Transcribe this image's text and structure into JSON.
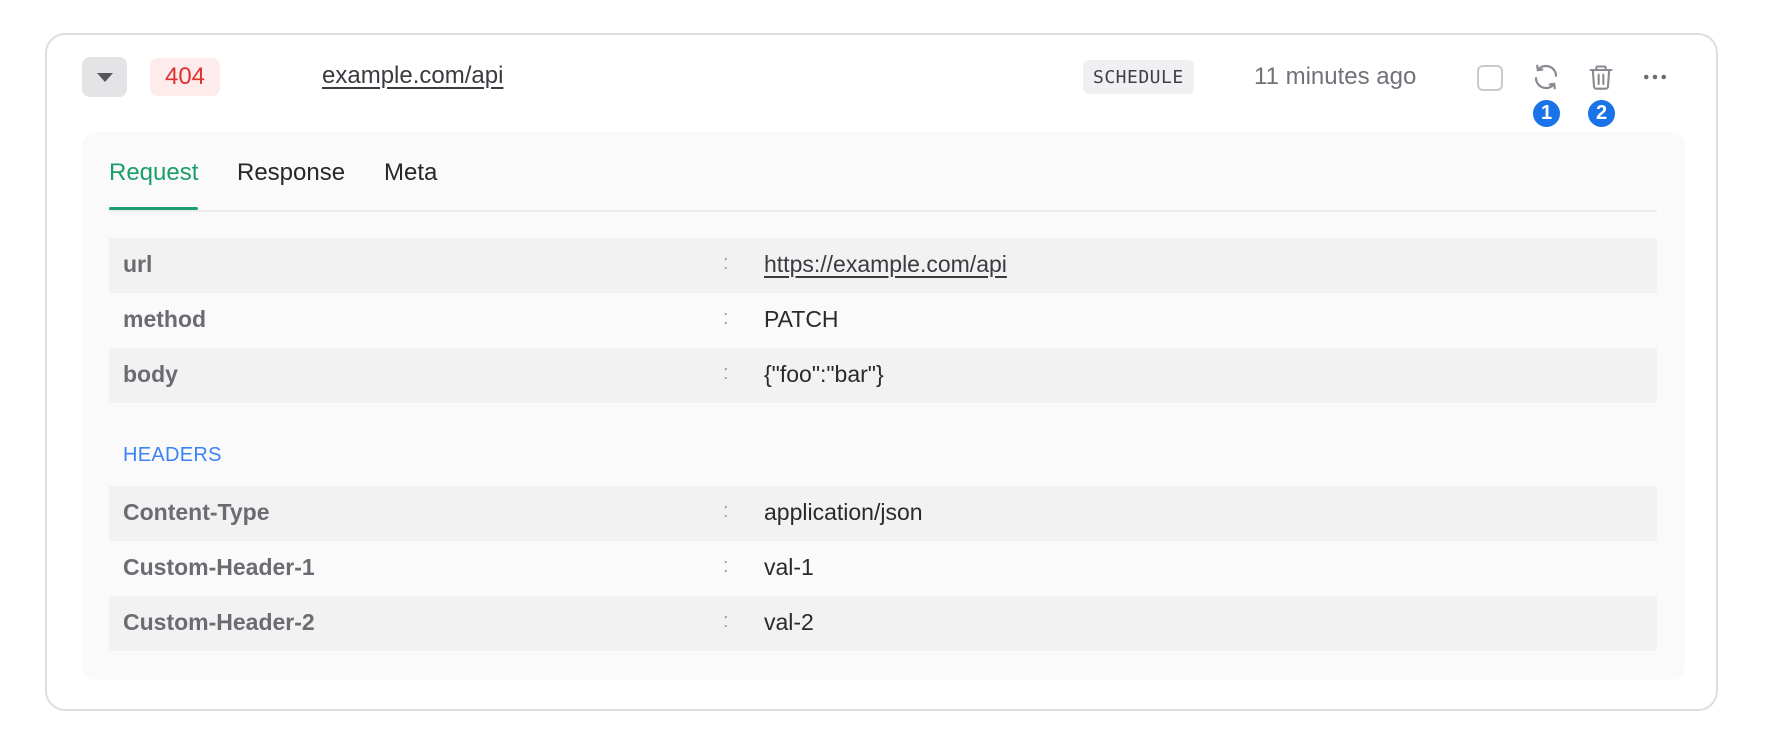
{
  "log": {
    "status_code": "404",
    "url": "example.com/api",
    "type": "SCHEDULE",
    "time_ago": "11 minutes ago"
  },
  "markers": [
    "1",
    "2"
  ],
  "tabs": [
    {
      "label": "Request",
      "active": true
    },
    {
      "label": "Response",
      "active": false
    },
    {
      "label": "Meta",
      "active": false
    }
  ],
  "request": {
    "fields": [
      {
        "key": "url",
        "sep": ":",
        "value": "https://example.com/api"
      },
      {
        "key": "method",
        "sep": ":",
        "value": "PATCH"
      },
      {
        "key": "body",
        "sep": ":",
        "value": "{\"foo\":\"bar\"}"
      }
    ],
    "headers_label": "HEADERS",
    "headers": [
      {
        "key": "Content-Type",
        "sep": ":",
        "value": "application/json"
      },
      {
        "key": "Custom-Header-1",
        "sep": ":",
        "value": "val-1"
      },
      {
        "key": "Custom-Header-2",
        "sep": ":",
        "value": "val-2"
      }
    ]
  },
  "icons": {
    "toggle": "caret-down-icon",
    "retry": "refresh-icon",
    "delete": "trash-icon",
    "more": "ellipsis-icon"
  },
  "colors": {
    "status_error": "#e03131",
    "tab_active": "#1a9e6b",
    "section_label": "#3b82f6",
    "marker": "#1a73e8"
  }
}
